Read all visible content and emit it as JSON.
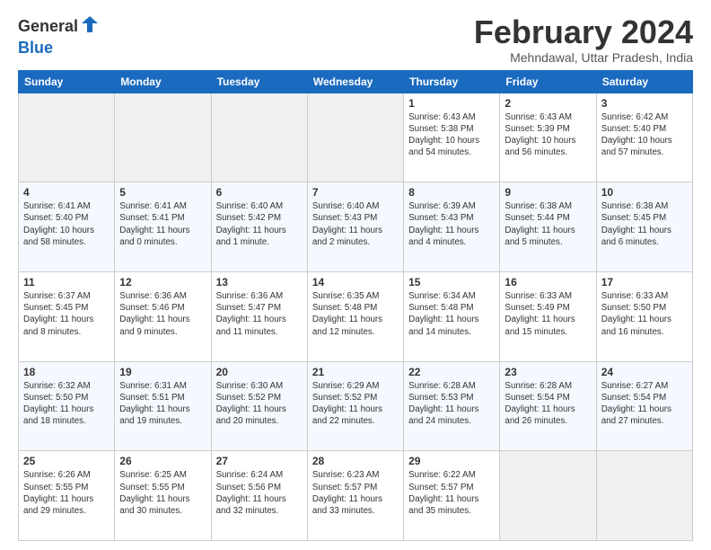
{
  "logo": {
    "general": "General",
    "blue": "Blue"
  },
  "header": {
    "month": "February 2024",
    "location": "Mehndawal, Uttar Pradesh, India"
  },
  "weekdays": [
    "Sunday",
    "Monday",
    "Tuesday",
    "Wednesday",
    "Thursday",
    "Friday",
    "Saturday"
  ],
  "weeks": [
    [
      {
        "day": "",
        "info": ""
      },
      {
        "day": "",
        "info": ""
      },
      {
        "day": "",
        "info": ""
      },
      {
        "day": "",
        "info": ""
      },
      {
        "day": "1",
        "info": "Sunrise: 6:43 AM\nSunset: 5:38 PM\nDaylight: 10 hours\nand 54 minutes."
      },
      {
        "day": "2",
        "info": "Sunrise: 6:43 AM\nSunset: 5:39 PM\nDaylight: 10 hours\nand 56 minutes."
      },
      {
        "day": "3",
        "info": "Sunrise: 6:42 AM\nSunset: 5:40 PM\nDaylight: 10 hours\nand 57 minutes."
      }
    ],
    [
      {
        "day": "4",
        "info": "Sunrise: 6:41 AM\nSunset: 5:40 PM\nDaylight: 10 hours\nand 58 minutes."
      },
      {
        "day": "5",
        "info": "Sunrise: 6:41 AM\nSunset: 5:41 PM\nDaylight: 11 hours\nand 0 minutes."
      },
      {
        "day": "6",
        "info": "Sunrise: 6:40 AM\nSunset: 5:42 PM\nDaylight: 11 hours\nand 1 minute."
      },
      {
        "day": "7",
        "info": "Sunrise: 6:40 AM\nSunset: 5:43 PM\nDaylight: 11 hours\nand 2 minutes."
      },
      {
        "day": "8",
        "info": "Sunrise: 6:39 AM\nSunset: 5:43 PM\nDaylight: 11 hours\nand 4 minutes."
      },
      {
        "day": "9",
        "info": "Sunrise: 6:38 AM\nSunset: 5:44 PM\nDaylight: 11 hours\nand 5 minutes."
      },
      {
        "day": "10",
        "info": "Sunrise: 6:38 AM\nSunset: 5:45 PM\nDaylight: 11 hours\nand 6 minutes."
      }
    ],
    [
      {
        "day": "11",
        "info": "Sunrise: 6:37 AM\nSunset: 5:45 PM\nDaylight: 11 hours\nand 8 minutes."
      },
      {
        "day": "12",
        "info": "Sunrise: 6:36 AM\nSunset: 5:46 PM\nDaylight: 11 hours\nand 9 minutes."
      },
      {
        "day": "13",
        "info": "Sunrise: 6:36 AM\nSunset: 5:47 PM\nDaylight: 11 hours\nand 11 minutes."
      },
      {
        "day": "14",
        "info": "Sunrise: 6:35 AM\nSunset: 5:48 PM\nDaylight: 11 hours\nand 12 minutes."
      },
      {
        "day": "15",
        "info": "Sunrise: 6:34 AM\nSunset: 5:48 PM\nDaylight: 11 hours\nand 14 minutes."
      },
      {
        "day": "16",
        "info": "Sunrise: 6:33 AM\nSunset: 5:49 PM\nDaylight: 11 hours\nand 15 minutes."
      },
      {
        "day": "17",
        "info": "Sunrise: 6:33 AM\nSunset: 5:50 PM\nDaylight: 11 hours\nand 16 minutes."
      }
    ],
    [
      {
        "day": "18",
        "info": "Sunrise: 6:32 AM\nSunset: 5:50 PM\nDaylight: 11 hours\nand 18 minutes."
      },
      {
        "day": "19",
        "info": "Sunrise: 6:31 AM\nSunset: 5:51 PM\nDaylight: 11 hours\nand 19 minutes."
      },
      {
        "day": "20",
        "info": "Sunrise: 6:30 AM\nSunset: 5:52 PM\nDaylight: 11 hours\nand 20 minutes."
      },
      {
        "day": "21",
        "info": "Sunrise: 6:29 AM\nSunset: 5:52 PM\nDaylight: 11 hours\nand 22 minutes."
      },
      {
        "day": "22",
        "info": "Sunrise: 6:28 AM\nSunset: 5:53 PM\nDaylight: 11 hours\nand 24 minutes."
      },
      {
        "day": "23",
        "info": "Sunrise: 6:28 AM\nSunset: 5:54 PM\nDaylight: 11 hours\nand 26 minutes."
      },
      {
        "day": "24",
        "info": "Sunrise: 6:27 AM\nSunset: 5:54 PM\nDaylight: 11 hours\nand 27 minutes."
      }
    ],
    [
      {
        "day": "25",
        "info": "Sunrise: 6:26 AM\nSunset: 5:55 PM\nDaylight: 11 hours\nand 29 minutes."
      },
      {
        "day": "26",
        "info": "Sunrise: 6:25 AM\nSunset: 5:55 PM\nDaylight: 11 hours\nand 30 minutes."
      },
      {
        "day": "27",
        "info": "Sunrise: 6:24 AM\nSunset: 5:56 PM\nDaylight: 11 hours\nand 32 minutes."
      },
      {
        "day": "28",
        "info": "Sunrise: 6:23 AM\nSunset: 5:57 PM\nDaylight: 11 hours\nand 33 minutes."
      },
      {
        "day": "29",
        "info": "Sunrise: 6:22 AM\nSunset: 5:57 PM\nDaylight: 11 hours\nand 35 minutes."
      },
      {
        "day": "",
        "info": ""
      },
      {
        "day": "",
        "info": ""
      }
    ]
  ]
}
